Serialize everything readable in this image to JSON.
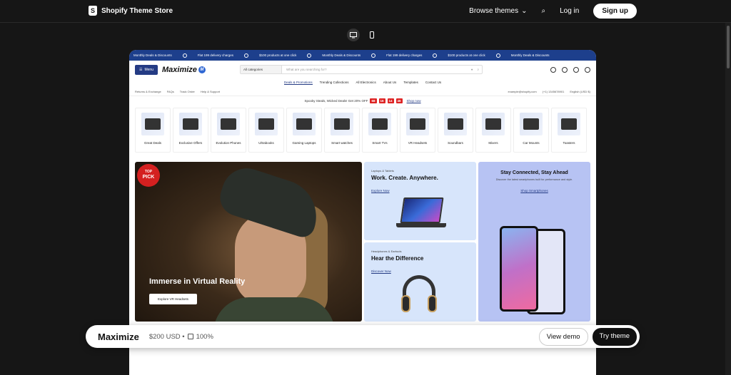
{
  "store": {
    "name": "Shopify Theme Store",
    "browse": "Browse themes",
    "login": "Log in",
    "signup": "Sign up"
  },
  "marquee": [
    "Monthly Deals & Discounts",
    "Flat 199 delivery charges",
    "$100 products at one click",
    "Monthly Deals & Discounts",
    "Flat 199 delivery charges",
    "$100 products at one click",
    "Monthly Deals & Discounts"
  ],
  "header": {
    "menu": "Menu",
    "logo": "Maximize",
    "logo_mark": "M",
    "search_category": "All categories",
    "search_placeholder": "What are you searching for?"
  },
  "menu_items": [
    "Deals & Promotions",
    "Trending Collections",
    "All Electronics",
    "About Us",
    "Templates",
    "Contact Us"
  ],
  "util_left": [
    "Returns & Exchange",
    "FAQs",
    "Track Order",
    "Help & Support"
  ],
  "util_right": [
    "example@shopify.com",
    "(+1) 1345678901",
    "English (USD $)"
  ],
  "promo": {
    "text": "Spooky Steals, Wicked Deals! Get 20% OFF",
    "digits": [
      "68",
      "16",
      "14",
      "46"
    ],
    "link": "Shop now"
  },
  "categories": [
    "Great Deals",
    "Exclusive Offers",
    "Evolution Phones",
    "Ultrabooks",
    "Gaming Laptops",
    "Smart watches",
    "Smart TVs",
    "VR Headsets",
    "Soundbars",
    "Mixers",
    "Car Mounts",
    "Toasters"
  ],
  "hero": {
    "badge_top": "TOP",
    "badge_bottom": "PICK",
    "title": "Immerse in Virtual Reality",
    "button": "Explore VR Headsets"
  },
  "tiles": {
    "laptops": {
      "eyebrow": "Laptops & Tablets",
      "title": "Work. Create. Anywhere.",
      "link": "Explore Now"
    },
    "audio": {
      "eyebrow": "Headphones & Earbuds",
      "title": "Hear the Difference",
      "link": "Discover Now"
    },
    "phones": {
      "title": "Stay Connected, Stay Ahead",
      "sub": "Discover the latest smartphones built for performance and style.",
      "link": "Shop Smartphones"
    }
  },
  "footer": {
    "theme": "Maximize",
    "price": "$200 USD •",
    "rating": "100%",
    "view_demo": "View demo",
    "try_theme": "Try theme"
  }
}
